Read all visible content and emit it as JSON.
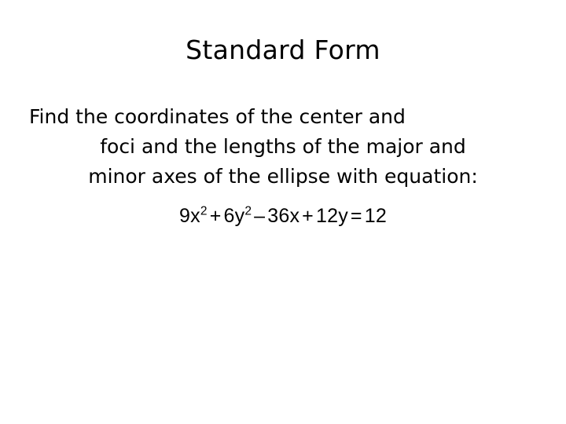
{
  "slide": {
    "background_color": "#FFFFFF",
    "text_color": "#000000",
    "title": "Standard Form",
    "body": {
      "lines": [
        "Find the coordinates of the center and",
        "foci and the lengths of the major and",
        "minor axes of the ellipse with equation:"
      ],
      "full_text": "Find the coordinates of the center and foci and the lengths of the major and minor axes of the ellipse with equation:"
    },
    "equation": {
      "full_text": "9x2 + 6y2 – 36x + 12y = 12",
      "terms": {
        "term1_coefficient": "9x",
        "term1_exponent": "2",
        "op1": "+",
        "term2_coefficient": "6y",
        "term2_exponent": "2",
        "op2": "–",
        "term3": "36x",
        "op3": "+",
        "term4": "12y",
        "op4": "=",
        "right_side": "12"
      }
    }
  }
}
